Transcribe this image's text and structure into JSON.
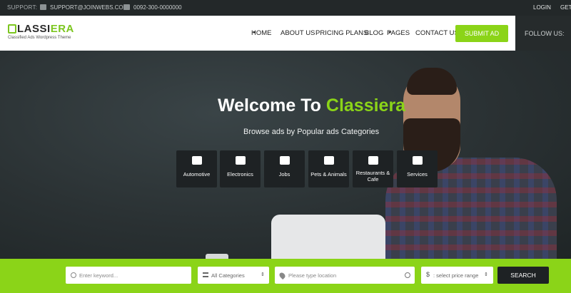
{
  "topbar": {
    "support_label": "SUPPORT:",
    "email": "SUPPORT@JOINWEBS.COM",
    "phone": "0092-300-0000000",
    "login": "LOGIN",
    "get": "GET"
  },
  "brand": {
    "name_part1": "LASSI",
    "name_part2": "ERA",
    "tagline": "Classified Ads Wordpress Theme",
    "accent": "#8bd418"
  },
  "nav": {
    "items": [
      "HOME",
      "ABOUT US",
      "PRICING PLANS",
      "BLOG",
      "PAGES",
      "CONTACT US"
    ],
    "submit": "SUBMIT AD",
    "follow": "FOLLOW US:"
  },
  "hero": {
    "title_white": "Welcome To ",
    "title_green": "Classiera",
    "subtitle": "Browse ads by Popular ads Categories"
  },
  "categories": [
    {
      "label": "Automotive",
      "icon": "car-icon"
    },
    {
      "label": "Electronics",
      "icon": "monitor-icon"
    },
    {
      "label": "Jobs",
      "icon": "suit-icon"
    },
    {
      "label": "Pets & Animals",
      "icon": "paw-icon"
    },
    {
      "label": "Restaurants & Cafe",
      "icon": "cutlery-icon"
    },
    {
      "label": "Services",
      "icon": "wrench-icon"
    }
  ],
  "search": {
    "keyword_placeholder": "Enter keyword...",
    "category_value": "All Categories",
    "location_placeholder": "Please type location",
    "price_value": ": select price range",
    "button": "SEARCH"
  }
}
